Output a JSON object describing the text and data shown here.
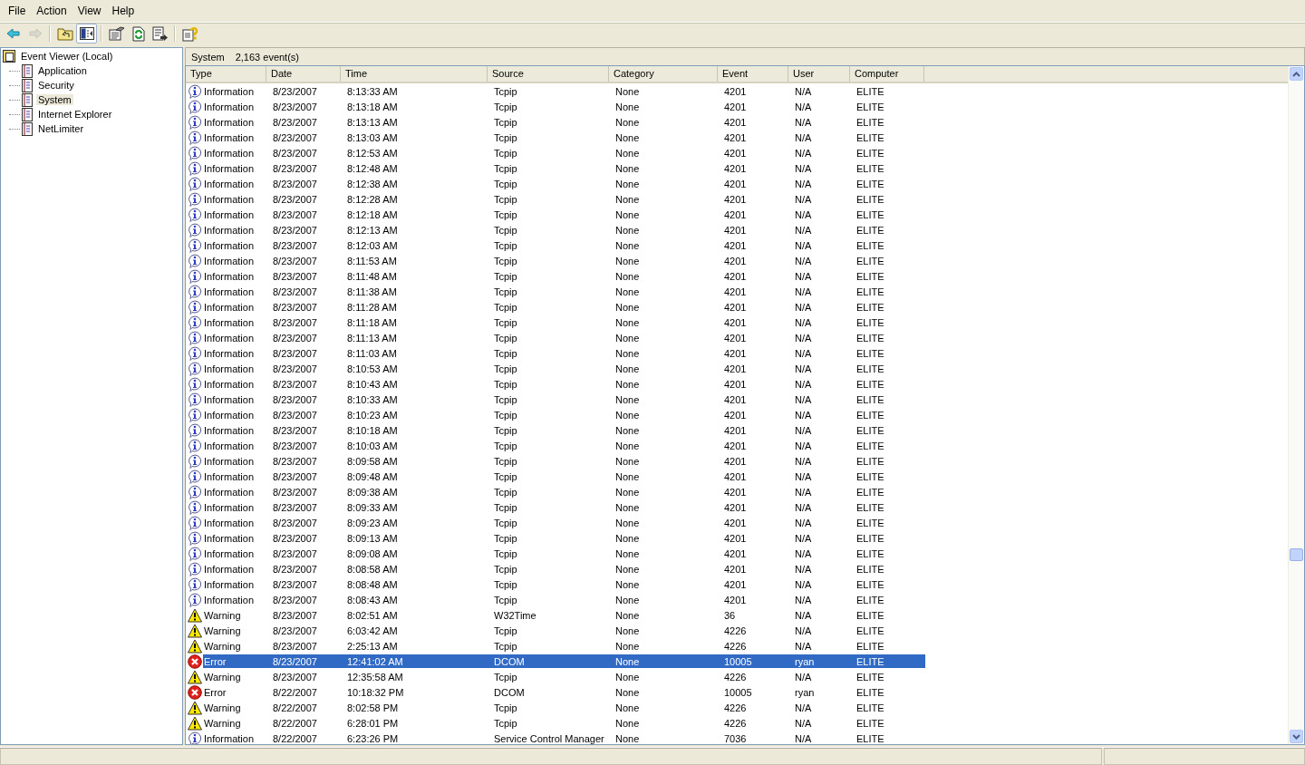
{
  "menu": [
    "File",
    "Action",
    "View",
    "Help"
  ],
  "toolbar": [
    {
      "kind": "back",
      "disabled": false,
      "pressed": false
    },
    {
      "kind": "forward",
      "disabled": true,
      "pressed": false
    },
    {
      "kind": "up",
      "disabled": false,
      "pressed": false
    },
    {
      "kind": "tree",
      "disabled": false,
      "pressed": true
    },
    {
      "kind": "properties",
      "disabled": false,
      "pressed": false
    },
    {
      "kind": "refresh",
      "disabled": false,
      "pressed": false
    },
    {
      "kind": "export",
      "disabled": false,
      "pressed": false
    },
    {
      "kind": "help",
      "disabled": false,
      "pressed": false
    }
  ],
  "tree": {
    "label": "Event Viewer (Local)",
    "children": [
      {
        "label": "Application",
        "selected": false
      },
      {
        "label": "Security",
        "selected": false
      },
      {
        "label": "System",
        "selected": true
      },
      {
        "label": "Internet Explorer",
        "selected": false
      },
      {
        "label": "NetLimiter",
        "selected": false
      }
    ]
  },
  "pane_header": {
    "title": "System",
    "count": "2,163 event(s)"
  },
  "table": {
    "columns": [
      "Type",
      "Date",
      "Time",
      "Source",
      "Category",
      "Event",
      "User",
      "Computer"
    ],
    "rows": [
      {
        "kind": "info",
        "selected": false,
        "cells": [
          "Information",
          "8/23/2007",
          "8:13:33 AM",
          "Tcpip",
          "None",
          "4201",
          "N/A",
          "ELITE"
        ]
      },
      {
        "kind": "info",
        "selected": false,
        "cells": [
          "Information",
          "8/23/2007",
          "8:13:18 AM",
          "Tcpip",
          "None",
          "4201",
          "N/A",
          "ELITE"
        ]
      },
      {
        "kind": "info",
        "selected": false,
        "cells": [
          "Information",
          "8/23/2007",
          "8:13:13 AM",
          "Tcpip",
          "None",
          "4201",
          "N/A",
          "ELITE"
        ]
      },
      {
        "kind": "info",
        "selected": false,
        "cells": [
          "Information",
          "8/23/2007",
          "8:13:03 AM",
          "Tcpip",
          "None",
          "4201",
          "N/A",
          "ELITE"
        ]
      },
      {
        "kind": "info",
        "selected": false,
        "cells": [
          "Information",
          "8/23/2007",
          "8:12:53 AM",
          "Tcpip",
          "None",
          "4201",
          "N/A",
          "ELITE"
        ]
      },
      {
        "kind": "info",
        "selected": false,
        "cells": [
          "Information",
          "8/23/2007",
          "8:12:48 AM",
          "Tcpip",
          "None",
          "4201",
          "N/A",
          "ELITE"
        ]
      },
      {
        "kind": "info",
        "selected": false,
        "cells": [
          "Information",
          "8/23/2007",
          "8:12:38 AM",
          "Tcpip",
          "None",
          "4201",
          "N/A",
          "ELITE"
        ]
      },
      {
        "kind": "info",
        "selected": false,
        "cells": [
          "Information",
          "8/23/2007",
          "8:12:28 AM",
          "Tcpip",
          "None",
          "4201",
          "N/A",
          "ELITE"
        ]
      },
      {
        "kind": "info",
        "selected": false,
        "cells": [
          "Information",
          "8/23/2007",
          "8:12:18 AM",
          "Tcpip",
          "None",
          "4201",
          "N/A",
          "ELITE"
        ]
      },
      {
        "kind": "info",
        "selected": false,
        "cells": [
          "Information",
          "8/23/2007",
          "8:12:13 AM",
          "Tcpip",
          "None",
          "4201",
          "N/A",
          "ELITE"
        ]
      },
      {
        "kind": "info",
        "selected": false,
        "cells": [
          "Information",
          "8/23/2007",
          "8:12:03 AM",
          "Tcpip",
          "None",
          "4201",
          "N/A",
          "ELITE"
        ]
      },
      {
        "kind": "info",
        "selected": false,
        "cells": [
          "Information",
          "8/23/2007",
          "8:11:53 AM",
          "Tcpip",
          "None",
          "4201",
          "N/A",
          "ELITE"
        ]
      },
      {
        "kind": "info",
        "selected": false,
        "cells": [
          "Information",
          "8/23/2007",
          "8:11:48 AM",
          "Tcpip",
          "None",
          "4201",
          "N/A",
          "ELITE"
        ]
      },
      {
        "kind": "info",
        "selected": false,
        "cells": [
          "Information",
          "8/23/2007",
          "8:11:38 AM",
          "Tcpip",
          "None",
          "4201",
          "N/A",
          "ELITE"
        ]
      },
      {
        "kind": "info",
        "selected": false,
        "cells": [
          "Information",
          "8/23/2007",
          "8:11:28 AM",
          "Tcpip",
          "None",
          "4201",
          "N/A",
          "ELITE"
        ]
      },
      {
        "kind": "info",
        "selected": false,
        "cells": [
          "Information",
          "8/23/2007",
          "8:11:18 AM",
          "Tcpip",
          "None",
          "4201",
          "N/A",
          "ELITE"
        ]
      },
      {
        "kind": "info",
        "selected": false,
        "cells": [
          "Information",
          "8/23/2007",
          "8:11:13 AM",
          "Tcpip",
          "None",
          "4201",
          "N/A",
          "ELITE"
        ]
      },
      {
        "kind": "info",
        "selected": false,
        "cells": [
          "Information",
          "8/23/2007",
          "8:11:03 AM",
          "Tcpip",
          "None",
          "4201",
          "N/A",
          "ELITE"
        ]
      },
      {
        "kind": "info",
        "selected": false,
        "cells": [
          "Information",
          "8/23/2007",
          "8:10:53 AM",
          "Tcpip",
          "None",
          "4201",
          "N/A",
          "ELITE"
        ]
      },
      {
        "kind": "info",
        "selected": false,
        "cells": [
          "Information",
          "8/23/2007",
          "8:10:43 AM",
          "Tcpip",
          "None",
          "4201",
          "N/A",
          "ELITE"
        ]
      },
      {
        "kind": "info",
        "selected": false,
        "cells": [
          "Information",
          "8/23/2007",
          "8:10:33 AM",
          "Tcpip",
          "None",
          "4201",
          "N/A",
          "ELITE"
        ]
      },
      {
        "kind": "info",
        "selected": false,
        "cells": [
          "Information",
          "8/23/2007",
          "8:10:23 AM",
          "Tcpip",
          "None",
          "4201",
          "N/A",
          "ELITE"
        ]
      },
      {
        "kind": "info",
        "selected": false,
        "cells": [
          "Information",
          "8/23/2007",
          "8:10:18 AM",
          "Tcpip",
          "None",
          "4201",
          "N/A",
          "ELITE"
        ]
      },
      {
        "kind": "info",
        "selected": false,
        "cells": [
          "Information",
          "8/23/2007",
          "8:10:03 AM",
          "Tcpip",
          "None",
          "4201",
          "N/A",
          "ELITE"
        ]
      },
      {
        "kind": "info",
        "selected": false,
        "cells": [
          "Information",
          "8/23/2007",
          "8:09:58 AM",
          "Tcpip",
          "None",
          "4201",
          "N/A",
          "ELITE"
        ]
      },
      {
        "kind": "info",
        "selected": false,
        "cells": [
          "Information",
          "8/23/2007",
          "8:09:48 AM",
          "Tcpip",
          "None",
          "4201",
          "N/A",
          "ELITE"
        ]
      },
      {
        "kind": "info",
        "selected": false,
        "cells": [
          "Information",
          "8/23/2007",
          "8:09:38 AM",
          "Tcpip",
          "None",
          "4201",
          "N/A",
          "ELITE"
        ]
      },
      {
        "kind": "info",
        "selected": false,
        "cells": [
          "Information",
          "8/23/2007",
          "8:09:33 AM",
          "Tcpip",
          "None",
          "4201",
          "N/A",
          "ELITE"
        ]
      },
      {
        "kind": "info",
        "selected": false,
        "cells": [
          "Information",
          "8/23/2007",
          "8:09:23 AM",
          "Tcpip",
          "None",
          "4201",
          "N/A",
          "ELITE"
        ]
      },
      {
        "kind": "info",
        "selected": false,
        "cells": [
          "Information",
          "8/23/2007",
          "8:09:13 AM",
          "Tcpip",
          "None",
          "4201",
          "N/A",
          "ELITE"
        ]
      },
      {
        "kind": "info",
        "selected": false,
        "cells": [
          "Information",
          "8/23/2007",
          "8:09:08 AM",
          "Tcpip",
          "None",
          "4201",
          "N/A",
          "ELITE"
        ]
      },
      {
        "kind": "info",
        "selected": false,
        "cells": [
          "Information",
          "8/23/2007",
          "8:08:58 AM",
          "Tcpip",
          "None",
          "4201",
          "N/A",
          "ELITE"
        ]
      },
      {
        "kind": "info",
        "selected": false,
        "cells": [
          "Information",
          "8/23/2007",
          "8:08:48 AM",
          "Tcpip",
          "None",
          "4201",
          "N/A",
          "ELITE"
        ]
      },
      {
        "kind": "info",
        "selected": false,
        "cells": [
          "Information",
          "8/23/2007",
          "8:08:43 AM",
          "Tcpip",
          "None",
          "4201",
          "N/A",
          "ELITE"
        ]
      },
      {
        "kind": "warning",
        "selected": false,
        "cells": [
          "Warning",
          "8/23/2007",
          "8:02:51 AM",
          "W32Time",
          "None",
          "36",
          "N/A",
          "ELITE"
        ]
      },
      {
        "kind": "warning",
        "selected": false,
        "cells": [
          "Warning",
          "8/23/2007",
          "6:03:42 AM",
          "Tcpip",
          "None",
          "4226",
          "N/A",
          "ELITE"
        ]
      },
      {
        "kind": "warning",
        "selected": false,
        "cells": [
          "Warning",
          "8/23/2007",
          "2:25:13 AM",
          "Tcpip",
          "None",
          "4226",
          "N/A",
          "ELITE"
        ]
      },
      {
        "kind": "error",
        "selected": true,
        "cells": [
          "Error",
          "8/23/2007",
          "12:41:02 AM",
          "DCOM",
          "None",
          "10005",
          "ryan",
          "ELITE"
        ]
      },
      {
        "kind": "warning",
        "selected": false,
        "cells": [
          "Warning",
          "8/23/2007",
          "12:35:58 AM",
          "Tcpip",
          "None",
          "4226",
          "N/A",
          "ELITE"
        ]
      },
      {
        "kind": "error",
        "selected": false,
        "cells": [
          "Error",
          "8/22/2007",
          "10:18:32 PM",
          "DCOM",
          "None",
          "10005",
          "ryan",
          "ELITE"
        ]
      },
      {
        "kind": "warning",
        "selected": false,
        "cells": [
          "Warning",
          "8/22/2007",
          "8:02:58 PM",
          "Tcpip",
          "None",
          "4226",
          "N/A",
          "ELITE"
        ]
      },
      {
        "kind": "warning",
        "selected": false,
        "cells": [
          "Warning",
          "8/22/2007",
          "6:28:01 PM",
          "Tcpip",
          "None",
          "4226",
          "N/A",
          "ELITE"
        ]
      },
      {
        "kind": "info",
        "selected": false,
        "cells": [
          "Information",
          "8/22/2007",
          "6:23:26 PM",
          "Service Control Manager",
          "None",
          "7036",
          "N/A",
          "ELITE"
        ]
      }
    ]
  }
}
